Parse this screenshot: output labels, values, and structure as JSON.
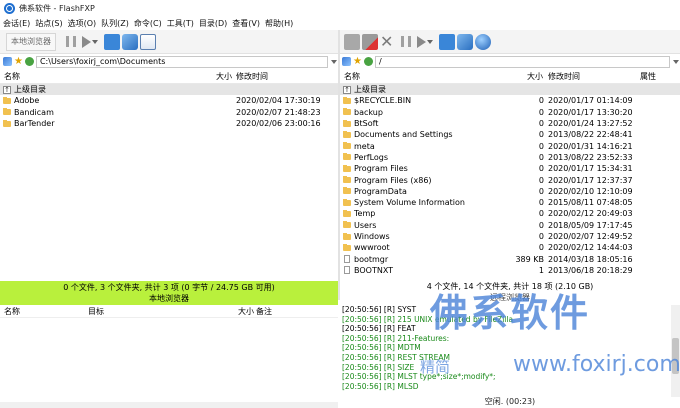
{
  "window": {
    "title": "佛系软件 - FlashFXP"
  },
  "menu": [
    "会话(E)",
    "站点(S)",
    "选项(O)",
    "队列(Z)",
    "命令(C)",
    "工具(T)",
    "目录(D)",
    "查看(V)",
    "帮助(H)"
  ],
  "local": {
    "toolbar_label": "本地浏览器",
    "path": "C:\\Users\\foxirj_com\\Documents",
    "columns": {
      "name": "名称",
      "size": "大小",
      "date": "修改时间"
    },
    "parent": "上级目录",
    "rows": [
      {
        "name": "Adobe",
        "date": "2020/02/04 17:30:19"
      },
      {
        "name": "Bandicam",
        "date": "2020/02/07 21:48:23"
      },
      {
        "name": "BarTender",
        "date": "2020/02/06 23:00:16"
      }
    ],
    "status_line1": "0 个文件, 3 个文件夹, 共计 3 项 (0 字节 / 24.75 GB 可用)",
    "status_line2": "本地浏览器"
  },
  "remote": {
    "path": "/",
    "columns": {
      "name": "名称",
      "size": "大小",
      "date": "修改时间",
      "attr": "属性"
    },
    "parent": "上级目录",
    "rows": [
      {
        "name": "$RECYCLE.BIN",
        "size": "0",
        "date": "2020/01/17 01:14:09",
        "type": "folder"
      },
      {
        "name": "backup",
        "size": "0",
        "date": "2020/01/17 13:30:20",
        "type": "folder"
      },
      {
        "name": "BtSoft",
        "size": "0",
        "date": "2020/01/24 13:27:52",
        "type": "folder"
      },
      {
        "name": "Documents and Settings",
        "size": "0",
        "date": "2013/08/22 22:48:41",
        "type": "folder"
      },
      {
        "name": "meta",
        "size": "0",
        "date": "2020/01/31 14:16:21",
        "type": "folder"
      },
      {
        "name": "PerfLogs",
        "size": "0",
        "date": "2013/08/22 23:52:33",
        "type": "folder"
      },
      {
        "name": "Program Files",
        "size": "0",
        "date": "2020/01/17 15:34:31",
        "type": "folder"
      },
      {
        "name": "Program Files (x86)",
        "size": "0",
        "date": "2020/01/17 12:37:37",
        "type": "folder"
      },
      {
        "name": "ProgramData",
        "size": "0",
        "date": "2020/02/10 12:10:09",
        "type": "folder"
      },
      {
        "name": "System Volume Information",
        "size": "0",
        "date": "2015/08/11 07:48:05",
        "type": "folder"
      },
      {
        "name": "Temp",
        "size": "0",
        "date": "2020/02/12 20:49:03",
        "type": "folder"
      },
      {
        "name": "Users",
        "size": "0",
        "date": "2018/05/09 17:17:45",
        "type": "folder"
      },
      {
        "name": "Windows",
        "size": "0",
        "date": "2020/02/07 12:49:52",
        "type": "folder"
      },
      {
        "name": "wwwroot",
        "size": "0",
        "date": "2020/02/12 14:44:03",
        "type": "folder"
      },
      {
        "name": "bootmgr",
        "size": "389 KB",
        "date": "2014/03/18 18:05:16",
        "type": "file"
      },
      {
        "name": "BOOTNXT",
        "size": "1",
        "date": "2013/06/18 20:18:29",
        "type": "file"
      }
    ],
    "status_line1": "4 个文件, 14 个文件夹, 共计 18 项 (2.10 GB)",
    "status_line2": "远程浏览器"
  },
  "queue": {
    "columns": {
      "name": "名称",
      "target": "目标",
      "size": "大小",
      "note": "备注"
    }
  },
  "log": {
    "lines": [
      {
        "text": "[20:50:56] [R] SYST",
        "color": "black"
      },
      {
        "text": "[20:50:56] [R] 215 UNIX emulated by FileZilla",
        "color": "green"
      },
      {
        "text": "[20:50:56] [R] FEAT",
        "color": "black"
      },
      {
        "text": "[20:50:56] [R] 211-Features:",
        "color": "green"
      },
      {
        "text": "[20:50:56] [R]  MDTM",
        "color": "green"
      },
      {
        "text": "[20:50:56] [R]  REST STREAM",
        "color": "green"
      },
      {
        "text": "[20:50:56] [R]  SIZE",
        "color": "green"
      },
      {
        "text": "[20:50:56] [R]  MLST type*;size*;modify*;",
        "color": "green"
      },
      {
        "text": "[20:50:56] [R]  MLSD",
        "color": "green"
      }
    ],
    "status": "空闲. (00:23)"
  },
  "watermark": {
    "brand": "佛系软件",
    "small": "精简",
    "url": "www.foxirj.com"
  }
}
